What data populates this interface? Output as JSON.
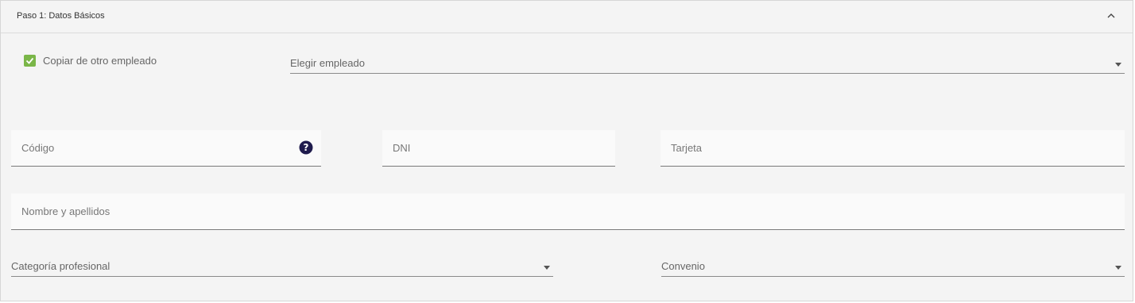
{
  "panel": {
    "title": "Paso 1: Datos Básicos",
    "collapse_icon": "chevron-up-icon"
  },
  "copy": {
    "checkbox_label": "Copiar de otro empleado",
    "checked": true,
    "checkbox_color": "#7ab648",
    "employee_select_placeholder": "Elegir empleado"
  },
  "fields": {
    "codigo": "Código",
    "dni": "DNI",
    "tarjeta": "Tarjeta",
    "nombre": "Nombre y apellidos",
    "help_icon": "question-circle-icon",
    "help_icon_color": "#1f1b4d"
  },
  "selects": {
    "categoria": "Categoría profesional",
    "convenio": "Convenio"
  }
}
